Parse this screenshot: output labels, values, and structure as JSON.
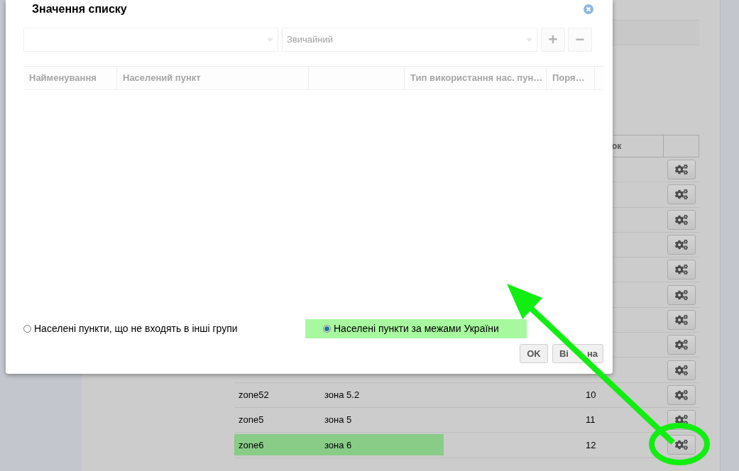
{
  "dialog": {
    "title": "Значення списку",
    "selects": [
      {
        "disabled": true
      },
      {
        "value": "Звичайний",
        "disabled": true
      }
    ],
    "tool_buttons": [
      {
        "label": "+",
        "disabled": true
      },
      {
        "label": "−",
        "disabled": true
      }
    ],
    "columns": [
      "Найменування",
      "Населений пункт",
      "",
      "Тип використання нас. пун…",
      "Поря…"
    ],
    "radios": [
      {
        "label": "Населені пункти, що не входять в інші групи",
        "selected": false,
        "highlighted": false
      },
      {
        "label": "Населені пункти за межами України",
        "selected": true,
        "highlighted": true
      }
    ],
    "buttons": [
      {
        "label_parts": [
          "OK"
        ]
      },
      {
        "label_parts": [
          "Ві",
          "на"
        ]
      }
    ]
  },
  "table": {
    "order_header": "ок",
    "rows": [
      {},
      {},
      {},
      {},
      {},
      {},
      {},
      {},
      {},
      {
        "code": "zone52",
        "name": "зона 5.2",
        "order": "10",
        "highlighted": false
      },
      {
        "code": "zone5",
        "name": "зона 5",
        "order": "11",
        "highlighted": false
      },
      {
        "code": "zone6",
        "name": "зона 6",
        "order": "12",
        "highlighted": true
      }
    ]
  }
}
